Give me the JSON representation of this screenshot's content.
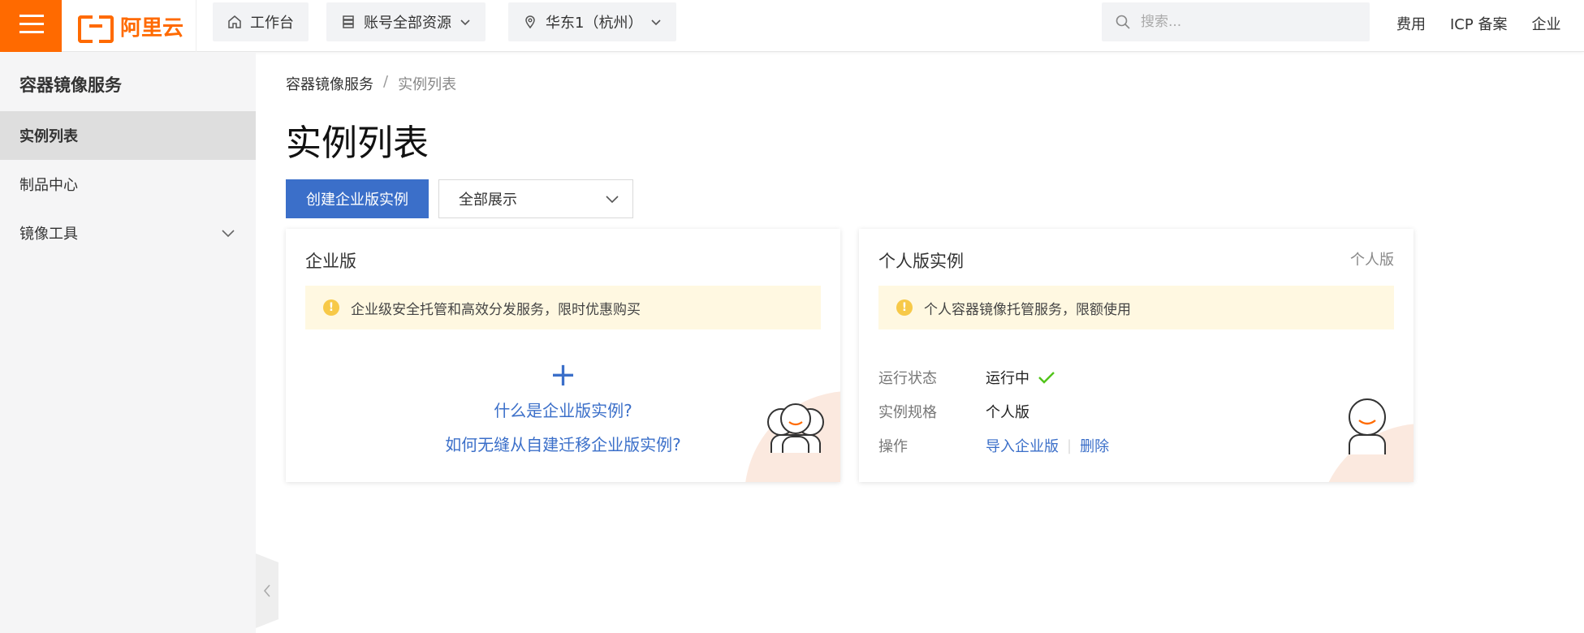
{
  "brand": {
    "name": "阿里云",
    "color": "#ff6a00"
  },
  "topbar": {
    "workbench": "工作台",
    "resources": "账号全部资源",
    "region": "华东1（杭州）",
    "search_placeholder": "搜索...",
    "links": [
      "费用",
      "ICP 备案",
      "企业"
    ]
  },
  "sidebar": {
    "title": "容器镜像服务",
    "items": [
      {
        "label": "实例列表",
        "active": true
      },
      {
        "label": "制品中心",
        "active": false
      },
      {
        "label": "镜像工具",
        "active": false,
        "expandable": true
      }
    ]
  },
  "main": {
    "breadcrumb": [
      "容器镜像服务",
      "实例列表"
    ],
    "title": "实例列表",
    "create_button": "创建企业版实例",
    "filter_select": "全部展示",
    "enterprise_card": {
      "title": "企业版",
      "notice": "企业级安全托管和高效分发服务，限时优惠购买",
      "link1": "什么是企业版实例?",
      "link2": "如何无缝从自建迁移企业版实例?"
    },
    "personal_card": {
      "title": "个人版实例",
      "badge": "个人版",
      "notice": "个人容器镜像托管服务，限额使用",
      "status_label": "运行状态",
      "status_value": "运行中",
      "spec_label": "实例规格",
      "spec_value": "个人版",
      "ops_label": "操作",
      "op_import": "导入企业版",
      "op_delete": "删除"
    }
  },
  "colors": {
    "accent": "#3b6fc9",
    "warning": "#f7c948",
    "success": "#52c41a"
  }
}
